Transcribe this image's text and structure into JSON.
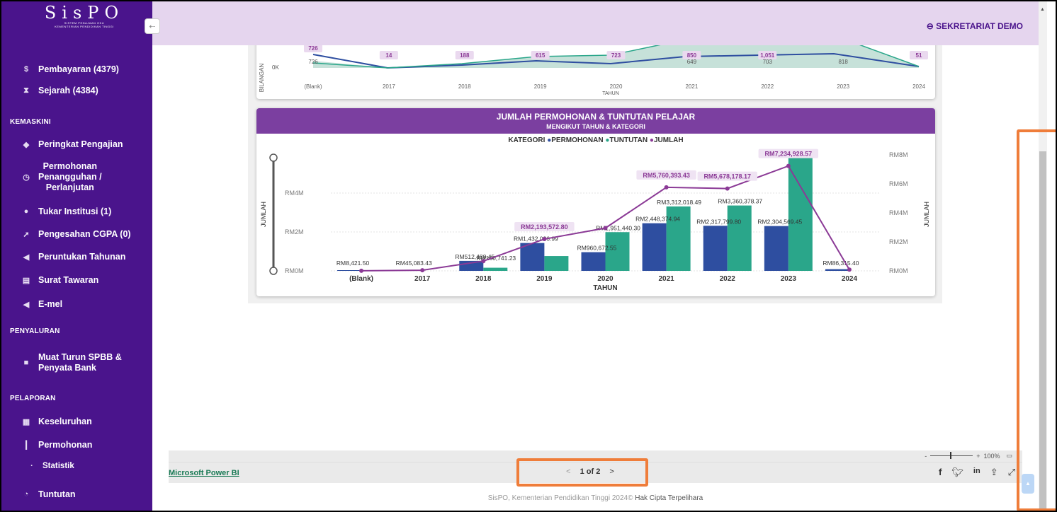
{
  "app": {
    "logo_text": "SisPO",
    "logo_sub1": "SISTEM PENAJAAN OKU",
    "logo_sub2": "KEMENTERIAN PENDIDIKAN TINGGI",
    "user_label": "SEKRETARIAT DEMO"
  },
  "sidebar": {
    "items_top": [
      {
        "label": "Pembayaran (4379)",
        "icon": "dollar-icon"
      },
      {
        "label": "Sejarah (4384)",
        "icon": "hourglass-icon"
      }
    ],
    "sections": [
      {
        "title": "KEMASKINI",
        "items": [
          {
            "label": "Peringkat Pengajian",
            "icon": "graduation-cap-icon"
          },
          {
            "label": "Permohonan\nPenangguhan /\nPerlanjutan",
            "icon": "clock-icon"
          },
          {
            "label": "Tukar Institusi (1)",
            "icon": "user-icon"
          },
          {
            "label": "Pengesahan CGPA (0)",
            "icon": "rocket-icon"
          },
          {
            "label": "Peruntukan Tahunan",
            "icon": "send-icon"
          },
          {
            "label": "Surat Tawaran",
            "icon": "document-icon"
          },
          {
            "label": "E-mel",
            "icon": "send-icon"
          }
        ]
      },
      {
        "title": "PENYALURAN",
        "items": [
          {
            "label": "Muat Turun SPBB &\nPenyata Bank",
            "icon": "folder-icon"
          }
        ]
      },
      {
        "title": "PELAPORAN",
        "items": [
          {
            "label": "Keseluruhan",
            "icon": "calculator-icon"
          },
          {
            "label": "Permohonan",
            "icon": "bar-chart-icon"
          },
          {
            "label": "Statistik",
            "icon": "dot-icon"
          },
          {
            "label": "Tuntutan",
            "icon": "chart-line-icon"
          }
        ]
      }
    ]
  },
  "top_chart": {
    "ylabel": "BILANGAN",
    "xlabel": "TAHUN",
    "y_tick": "0K",
    "categories": [
      "(Blank)",
      "2017",
      "2018",
      "2019",
      "2020",
      "2021",
      "2022",
      "2023",
      "2024"
    ],
    "lower_labels": [
      "726",
      "",
      "",
      "",
      "",
      "649",
      "703",
      "818",
      ""
    ],
    "badge_labels": [
      "726",
      "14",
      "188",
      "615",
      "723",
      "850",
      "1,051",
      "",
      "51"
    ]
  },
  "chart_data": {
    "type": "bar",
    "title": "JUMLAH PERMOHONAN & TUNTUTAN PELAJAR",
    "subtitle": "MENGIKUT TAHUN & KATEGORI",
    "legend_title": "KATEGORI",
    "xlabel": "TAHUN",
    "ylabel": "JUMLAH",
    "ylabel_right": "JUMLAH",
    "categories": [
      "(Blank)",
      "2017",
      "2018",
      "2019",
      "2020",
      "2021",
      "2022",
      "2023",
      "2024"
    ],
    "ylim": [
      0,
      4000000
    ],
    "y_ticks": [
      "RM0M",
      "RM2M",
      "RM4M"
    ],
    "ylim_right": [
      0,
      8000000
    ],
    "y_ticks_right": [
      "RM0M",
      "RM2M",
      "RM4M",
      "RM6M",
      "RM8M"
    ],
    "series": [
      {
        "name": "PERMOHONAN",
        "color": "#2e4ea0",
        "axis": "left",
        "values": [
          8421.5,
          45083.43,
          512480.45,
          1432086.99,
          960672.55,
          2448374.94,
          2317799.8,
          2304569.45,
          86315.4
        ],
        "labels": [
          "RM8,421.50",
          "RM45,083.43",
          "RM512,480.45",
          "RM1,432,086.99",
          "RM960,672.55",
          "RM2,448,374.94",
          "RM2,317,799.80",
          "RM2,304,569.45",
          "RM86,315.40"
        ]
      },
      {
        "name": "TUNTUTAN",
        "color": "#2aa68a",
        "axis": "left",
        "values": [
          0,
          0,
          160741.23,
          761485.81,
          1990767.75,
          3312018.49,
          3360378.37,
          5930359.12,
          0
        ],
        "labels": [
          "",
          "",
          "RM160,741.23",
          "",
          "RM1,951,440.30",
          "RM3,312,018.49",
          "RM3,360,378.37",
          "",
          ""
        ]
      },
      {
        "name": "JUMLAH",
        "color": "#8b3a96",
        "axis": "right",
        "type": "line",
        "values": [
          8421.5,
          45083.43,
          673221.68,
          2193572.8,
          2951440.3,
          5760393.43,
          5678178.17,
          7234928.57,
          86315.4
        ],
        "labels": [
          "",
          "",
          "",
          "RM2,193,572.80",
          "",
          "RM5,760,393.43",
          "RM5,678,178.17",
          "RM7,234,928.57",
          ""
        ]
      }
    ]
  },
  "report_bar": {
    "pbi_link": "Microsoft Power BI",
    "pager_prev": "<",
    "pager_text": "1 of 2",
    "pager_next": ">",
    "zoom": "100%",
    "zoom_minus": "-",
    "zoom_plus": "+"
  },
  "footer": {
    "text": "SisPO, Kementerian Pendidikan Tinggi 2024©",
    "rights": "Hak Cipta Terpelihara"
  },
  "colors": {
    "sidebar": "#4a148c",
    "topbar": "#e5d5ee",
    "chart_header": "#7b3fa0",
    "annotation": "#ef7d3a"
  }
}
